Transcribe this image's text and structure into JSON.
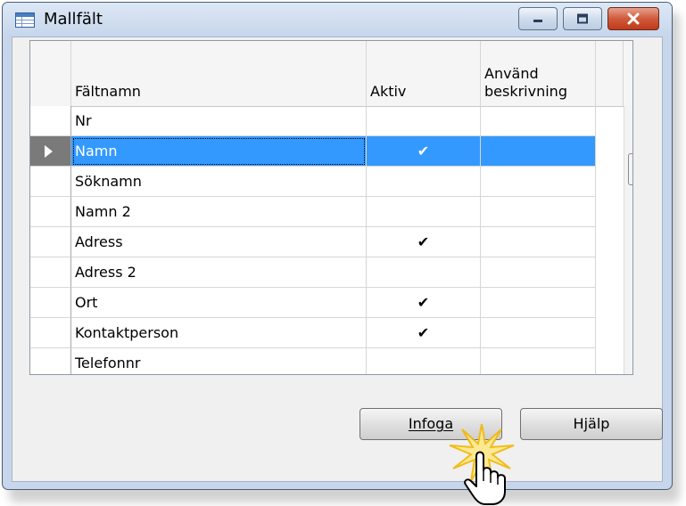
{
  "window": {
    "title": "Mallfält",
    "title_icon": "table-window-icon",
    "caption_buttons": [
      "minimize-icon",
      "maximize-icon",
      "close-icon"
    ]
  },
  "grid": {
    "columns": [
      {
        "label": ""
      },
      {
        "label": "Fältnamn"
      },
      {
        "label": "Aktiv"
      },
      {
        "label": "Använd\nbeskrivning"
      },
      {
        "label": ""
      }
    ],
    "rows": [
      {
        "name": "Nr",
        "aktiv": "",
        "anvand": ""
      },
      {
        "name": "Namn",
        "aktiv": "✔",
        "anvand": ""
      },
      {
        "name": "Söknamn",
        "aktiv": "",
        "anvand": ""
      },
      {
        "name": "Namn 2",
        "aktiv": "",
        "anvand": ""
      },
      {
        "name": "Adress",
        "aktiv": "✔",
        "anvand": ""
      },
      {
        "name": "Adress 2",
        "aktiv": "",
        "anvand": ""
      },
      {
        "name": "Ort",
        "aktiv": "✔",
        "anvand": ""
      },
      {
        "name": "Kontaktperson",
        "aktiv": "✔",
        "anvand": ""
      },
      {
        "name": "Telefonnr",
        "aktiv": "",
        "anvand": ""
      }
    ],
    "selected_row": "Namn"
  },
  "buttons": {
    "insert": "Infoga",
    "help": "Hjälp"
  },
  "colors": {
    "selection": "#3399ff",
    "window_frame": "#c7d6ea",
    "close_button": "#d05a3c"
  }
}
